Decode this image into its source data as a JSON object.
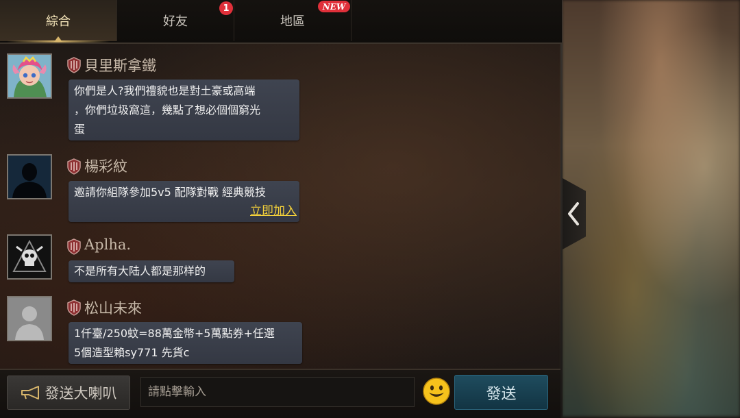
{
  "tabs": [
    {
      "label": "綜合",
      "active": true
    },
    {
      "label": "好友",
      "badge_count": "1"
    },
    {
      "label": "地區",
      "badge_text": "NEW"
    }
  ],
  "messages": [
    {
      "username": "貝里斯拿鐵",
      "avatar": "cartoon-character-avatar",
      "lines": [
        "你們是人?我們禮貌也是對土豪或高端",
        "，你們垃圾窩這，幾點了想必個個窮光",
        "蛋"
      ]
    },
    {
      "username": "楊彩紋",
      "avatar": "silhouette-avatar",
      "lines": [
        "邀請你組隊參加5v5 配隊對戰 經典競技"
      ],
      "link": "立即加入"
    },
    {
      "username": "Aplha.",
      "avatar": "skull-emblem-avatar",
      "lines": [
        "不是所有大陆人都是那样的"
      ]
    },
    {
      "username": "松山未來",
      "avatar": "default-gray-avatar",
      "lines": [
        "1仟臺/250蚊=88萬金幣+5萬點券+任選",
        "5個造型賴sy771 先貨c"
      ]
    }
  ],
  "footer": {
    "horn_label": "發送大喇叭",
    "input_placeholder": "請點擊輸入",
    "send_label": "發送"
  },
  "colors": {
    "link": "#f5d23a",
    "badge": "#e0303a",
    "bubble": "#3f4450",
    "send_button": "#1f4c5e"
  }
}
